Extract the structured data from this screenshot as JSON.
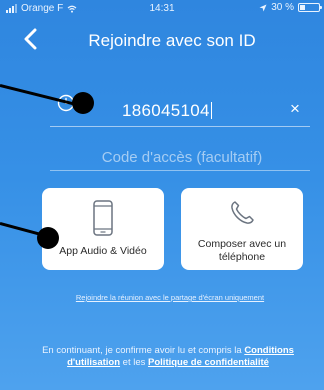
{
  "status_bar": {
    "carrier": "Orange F",
    "time": "14:31",
    "battery": "30 %",
    "battery_level": 0.3
  },
  "header": {
    "title": "Rejoindre avec son ID",
    "back_icon": "chevron-left-icon"
  },
  "meeting_id": {
    "value": "186045104",
    "clear_label": "×",
    "leading_icon": "clock-icon"
  },
  "access_code": {
    "placeholder": "Code d'accès (facultatif)"
  },
  "options": {
    "audio_video_label": "App Audio & Vidéo",
    "phone_label": "Composer avec un téléphone"
  },
  "share_screen_link": "Rejoindre la réunion avec le partage d'écran uniquement",
  "legal": {
    "prefix": "En continuant, je confirme avoir lu et compris la",
    "terms_link": "Conditions d'utilisation",
    "middle": "et les",
    "privacy_link": "Politique de confidentialité"
  },
  "colors": {
    "background_top": "#2f86df",
    "background_bottom": "#4ea2ee",
    "card": "#ffffff",
    "marker": "#000000"
  }
}
